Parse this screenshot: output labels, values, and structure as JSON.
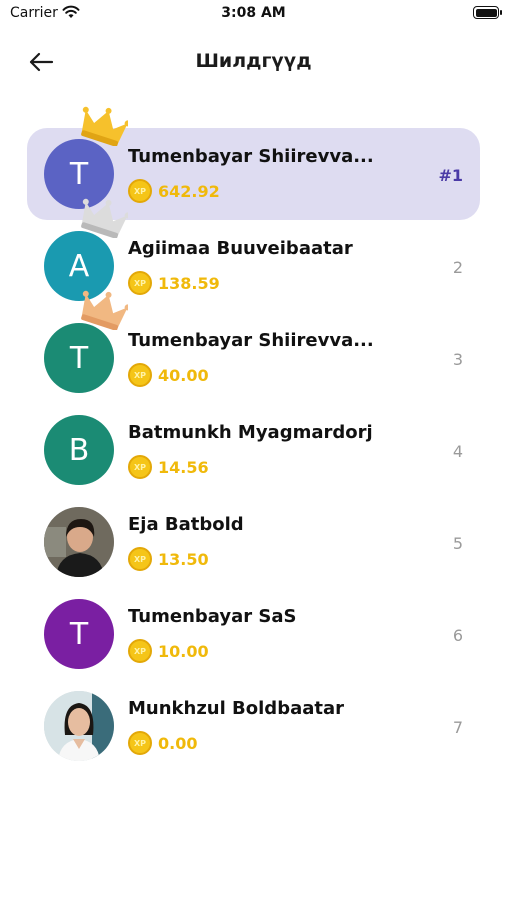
{
  "status_bar": {
    "carrier": "Carrier",
    "time": "3:08 AM"
  },
  "header": {
    "title": "Шилдгүүд",
    "back_icon": "arrow-left-icon"
  },
  "colors": {
    "accent": "#4a3aa6",
    "highlight": "#dedcf1",
    "xp": "#f0b90b"
  },
  "leaderboard": [
    {
      "initial": "T",
      "name": "Tumenbayar Shiirevva...",
      "xp": "642.92",
      "rank": "#1",
      "avatar_color": "#5b63c4",
      "crown": "gold"
    },
    {
      "initial": "A",
      "name": "Agiimaa Buuveibaatar",
      "xp": "138.59",
      "rank": "2",
      "avatar_color": "#1a9ab0",
      "crown": "silver"
    },
    {
      "initial": "T",
      "name": "Tumenbayar Shiirevva...",
      "xp": "40.00",
      "rank": "3",
      "avatar_color": "#1b8b74",
      "crown": "bronze"
    },
    {
      "initial": "B",
      "name": "Batmunkh Myagmardorj",
      "xp": "14.56",
      "rank": "4",
      "avatar_color": "#1b8b74",
      "crown": ""
    },
    {
      "initial": "",
      "name": "Eja Batbold",
      "xp": "13.50",
      "rank": "5",
      "avatar_color": "",
      "crown": ""
    },
    {
      "initial": "T",
      "name": "Tumenbayar SaS",
      "xp": "10.00",
      "rank": "6",
      "avatar_color": "#7a1fa2",
      "crown": ""
    },
    {
      "initial": "",
      "name": "Munkhzul Boldbaatar",
      "xp": "0.00",
      "rank": "7",
      "avatar_color": "",
      "crown": ""
    }
  ],
  "coin_label": "XP"
}
